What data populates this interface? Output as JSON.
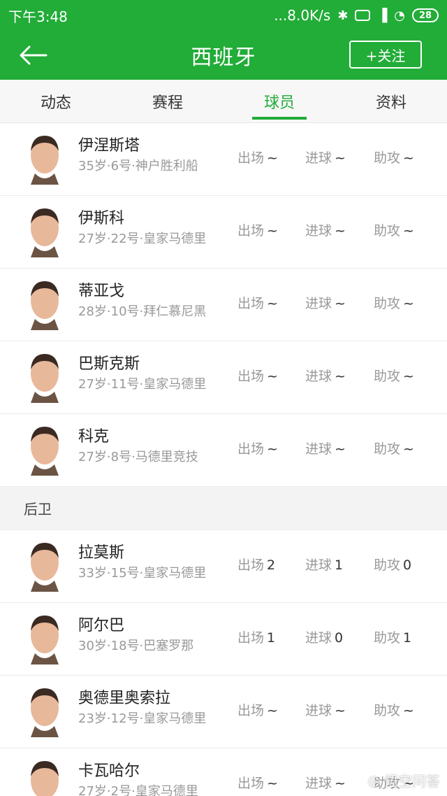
{
  "status_bar": {
    "time": "下午3:48",
    "net_speed": "...8.0K/s",
    "battery": "28"
  },
  "header": {
    "title": "西班牙",
    "follow_label": "+关注"
  },
  "tabs": [
    {
      "label": "动态"
    },
    {
      "label": "赛程"
    },
    {
      "label": "球员"
    },
    {
      "label": "资料"
    }
  ],
  "stat_labels": {
    "appearances": "出场",
    "goals": "进球",
    "assists": "助攻"
  },
  "midfielders": [
    {
      "name": "伊涅斯塔",
      "sub": "35岁·6号·神户胜利船",
      "appearances": "~",
      "goals": "~",
      "assists": "~"
    },
    {
      "name": "伊斯科",
      "sub": "27岁·22号·皇家马德里",
      "appearances": "~",
      "goals": "~",
      "assists": "~"
    },
    {
      "name": "蒂亚戈",
      "sub": "28岁·10号·拜仁慕尼黑",
      "appearances": "~",
      "goals": "~",
      "assists": "~"
    },
    {
      "name": "巴斯克斯",
      "sub": "27岁·11号·皇家马德里",
      "appearances": "~",
      "goals": "~",
      "assists": "~"
    },
    {
      "name": "科克",
      "sub": "27岁·8号·马德里竞技",
      "appearances": "~",
      "goals": "~",
      "assists": "~"
    }
  ],
  "defenders_section": {
    "title": "后卫"
  },
  "defenders": [
    {
      "name": "拉莫斯",
      "sub": "33岁·15号·皇家马德里",
      "appearances": "2",
      "goals": "1",
      "assists": "0"
    },
    {
      "name": "阿尔巴",
      "sub": "30岁·18号·巴塞罗那",
      "appearances": "1",
      "goals": "0",
      "assists": "1"
    },
    {
      "name": "奥德里奥索拉",
      "sub": "23岁·12号·皇家马德里",
      "appearances": "~",
      "goals": "~",
      "assists": "~"
    },
    {
      "name": "卡瓦哈尔",
      "sub": "27岁·2号·皇家马德里",
      "appearances": "~",
      "goals": "~",
      "assists": "~"
    }
  ],
  "watermark": "悟空问答",
  "colors": {
    "brand": "#22ac38",
    "skin": "#e8b89a",
    "hair": "#3a2a22"
  }
}
